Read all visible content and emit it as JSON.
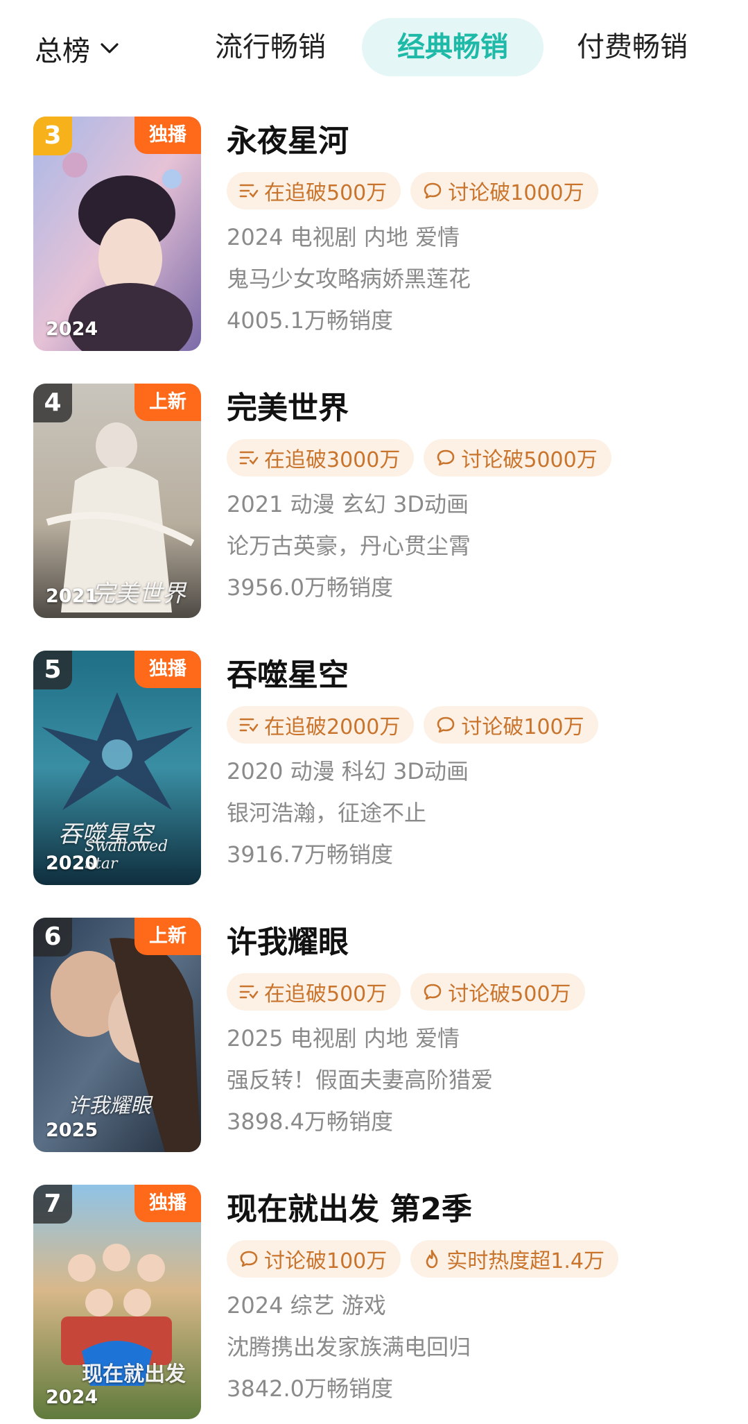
{
  "header": {
    "rank_selector": {
      "label": "总榜",
      "icon": "chevron-down-icon"
    },
    "tabs": [
      {
        "label": "流行畅销",
        "active": false
      },
      {
        "label": "经典畅销",
        "active": true
      },
      {
        "label": "付费畅销",
        "active": false
      }
    ]
  },
  "colors": {
    "active_tab_text": "#1fb9a8",
    "active_tab_bg": "#e4f6f5",
    "chip_bg": "#fdf1e6",
    "chip_text": "#c9742c",
    "tag_badge": "#ff6a1a",
    "rank_gold": "#f7b21b"
  },
  "items": [
    {
      "rank": "3",
      "tag": "独播",
      "poster_year": "2024",
      "title": "永夜星河",
      "chips": [
        {
          "icon": "playlist-icon",
          "label": "在追破500万"
        },
        {
          "icon": "comment-icon",
          "label": "讨论破1000万"
        }
      ],
      "meta": "2024 电视剧 内地 爱情",
      "tagline": "鬼马少女攻略病娇黑莲花",
      "sales": "4005.1万畅销度"
    },
    {
      "rank": "4",
      "tag": "上新",
      "poster_year": "2021",
      "poster_art_title": "完美世界",
      "title": "完美世界",
      "chips": [
        {
          "icon": "playlist-icon",
          "label": "在追破3000万"
        },
        {
          "icon": "comment-icon",
          "label": "讨论破5000万"
        }
      ],
      "meta": "2021 动漫 玄幻 3D动画",
      "tagline": "论万古英豪，丹心贯尘霄",
      "sales": "3956.0万畅销度"
    },
    {
      "rank": "5",
      "tag": "独播",
      "poster_year": "2020",
      "poster_art_title": "吞噬星空",
      "poster_art_subtitle": "Swallowed Star",
      "title": "吞噬星空",
      "chips": [
        {
          "icon": "playlist-icon",
          "label": "在追破2000万"
        },
        {
          "icon": "comment-icon",
          "label": "讨论破100万"
        }
      ],
      "meta": "2020 动漫 科幻 3D动画",
      "tagline": "银河浩瀚，征途不止",
      "sales": "3916.7万畅销度"
    },
    {
      "rank": "6",
      "tag": "上新",
      "poster_year": "2025",
      "poster_art_title": "许我耀眼",
      "title": "许我耀眼",
      "chips": [
        {
          "icon": "playlist-icon",
          "label": "在追破500万"
        },
        {
          "icon": "comment-icon",
          "label": "讨论破500万"
        }
      ],
      "meta": "2025 电视剧 内地 爱情",
      "tagline": "强反转！假面夫妻高阶猎爱",
      "sales": "3898.4万畅销度"
    },
    {
      "rank": "7",
      "tag": "独播",
      "poster_year": "2024",
      "poster_art_title": "现在就出发",
      "title": "现在就出发 第2季",
      "chips": [
        {
          "icon": "comment-icon",
          "label": "讨论破100万"
        },
        {
          "icon": "flame-icon",
          "label": "实时热度超1.4万"
        }
      ],
      "meta": "2024 综艺 游戏",
      "tagline": "沈腾携出发家族满电回归",
      "sales": "3842.0万畅销度"
    }
  ]
}
